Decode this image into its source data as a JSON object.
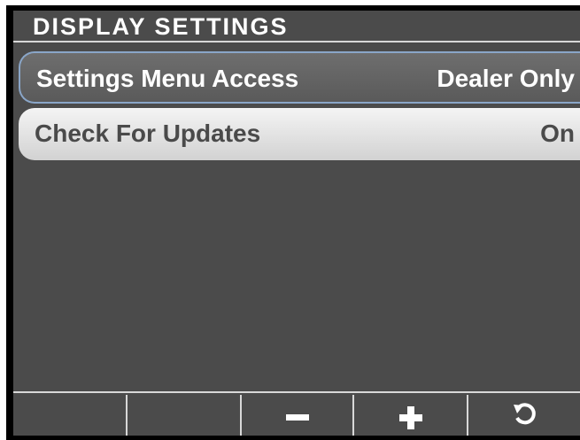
{
  "header": {
    "title": "DISPLAY SETTINGS"
  },
  "menu": {
    "items": [
      {
        "label": "Settings Menu Access",
        "value": "Dealer Only",
        "selected": true
      },
      {
        "label": "Check For Updates",
        "value": "On",
        "selected": false
      }
    ]
  },
  "softkeys": [
    {
      "icon": "blank"
    },
    {
      "icon": "blank"
    },
    {
      "icon": "minus-icon"
    },
    {
      "icon": "plus-icon"
    },
    {
      "icon": "back-arrow-icon"
    }
  ],
  "colors": {
    "background": "#4b4b4b",
    "frame": "#000000",
    "selected_border": "#8aa6c8",
    "row_light": "#e6e6e6",
    "text_light": "#ffffff",
    "text_dark": "#4a4a4a"
  }
}
